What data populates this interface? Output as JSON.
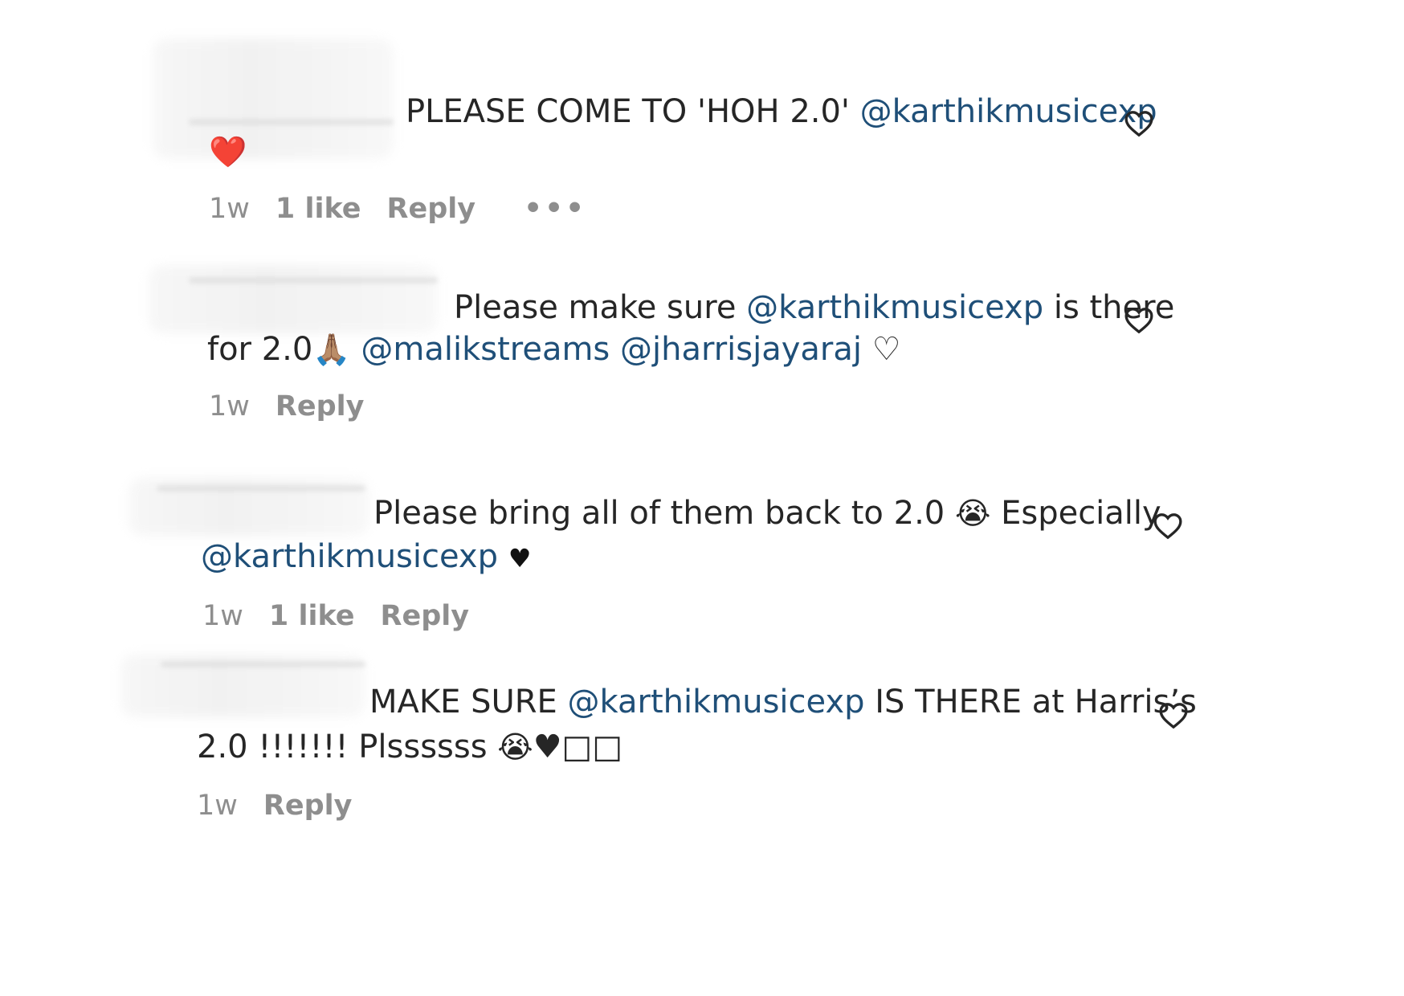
{
  "comments": [
    {
      "text_before": "PLEASE COME TO 'HOH 2.0' ",
      "mention_1": "@karthikmusicexp",
      "line2_emoji": "❤️",
      "time": "1w",
      "likes": "1 like",
      "reply": "Reply",
      "more": "•••"
    },
    {
      "text_before": "Please make sure ",
      "mention_1": "@karthikmusicexp",
      "text_after": " is there",
      "line2_text": "for 2.0",
      "line2_emoji": "🙏🏽",
      "mention_2": "@malikstreams",
      "mention_3": "@jharrisjayaraj",
      "line2_heart": "♡",
      "time": "1w",
      "reply": "Reply"
    },
    {
      "text_before": "Please bring all of them back to 2.0 ",
      "emoji_1": "😭",
      "text_after": " Especially",
      "mention_1": "@karthikmusicexp",
      "line2_heart": "♥",
      "time": "1w",
      "likes": "1 like",
      "reply": "Reply"
    },
    {
      "text_before": "MAKE SURE ",
      "mention_1": "@karthikmusicexp",
      "text_after": " IS THERE at Harris’s",
      "line2_text": "2.0 !!!!!!! Plssssss ",
      "emoji_1": "😭",
      "line2_tail": "♥□□",
      "time": "1w",
      "reply": "Reply"
    }
  ],
  "icons": {
    "like": "heart-outline-icon",
    "more": "more-horizontal-icon"
  }
}
